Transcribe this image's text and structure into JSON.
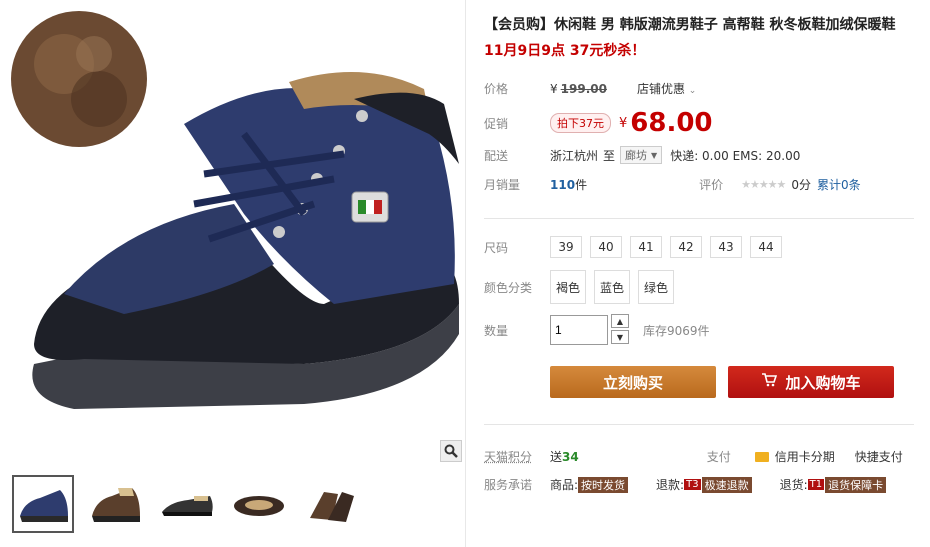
{
  "product": {
    "title": "【会员购】休闲鞋 男 韩版潮流男鞋子 高帮鞋 秋冬板鞋加绒保暖鞋",
    "promo": "11月9日9点 37元秒杀！"
  },
  "price": {
    "label": "价格",
    "currency": "¥",
    "original": "199.00",
    "store_discount": "店铺优惠"
  },
  "promotion": {
    "label": "促销",
    "tag": "拍下37元",
    "currency": "¥",
    "value": "68.00"
  },
  "shipping": {
    "label": "配送",
    "from": "浙江杭州",
    "to_word": "至",
    "destination": "廊坊",
    "fees": "快递: 0.00 EMS: 20.00"
  },
  "sales": {
    "label": "月销量",
    "count": "110",
    "unit": "件",
    "rating_label": "评价",
    "score": "0分",
    "total_reviews": "累计0条",
    "stars": "★★★★★"
  },
  "size": {
    "label": "尺码",
    "options": [
      "39",
      "40",
      "41",
      "42",
      "43",
      "44"
    ]
  },
  "color": {
    "label": "颜色分类",
    "options": [
      "褐色",
      "蓝色",
      "绿色"
    ]
  },
  "quantity": {
    "label": "数量",
    "value": "1",
    "stock": "库存9069件"
  },
  "actions": {
    "buy": "立刻购买",
    "cart": "加入购物车"
  },
  "points": {
    "label": "天猫积分",
    "give": "送",
    "amount": "34",
    "pay_label": "支付",
    "installment": "信用卡分期",
    "quick_pay": "快捷支付"
  },
  "service": {
    "label": "服务承诺",
    "goods": "商品:",
    "goods_tag": "按时发货",
    "refund": "退款:",
    "refund_t": "T3",
    "refund_tag": "极速退款",
    "return": "退货:",
    "return_t": "T1",
    "return_tag": "退货保障卡"
  },
  "colors": {
    "accent": "#c40000",
    "buy_button": "#c27a2c",
    "cart_button": "#c41e14"
  }
}
